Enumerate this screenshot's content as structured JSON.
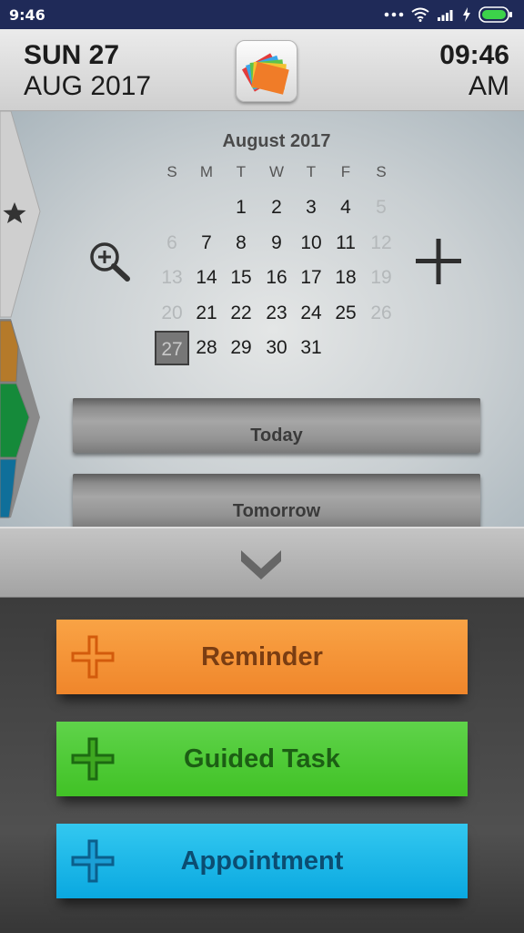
{
  "status_bar": {
    "time": "9:46"
  },
  "header": {
    "day_label": "SUN 27",
    "month_year": "AUG 2017",
    "time": "09:46",
    "ampm": "AM",
    "logo_icon": "stacked-cards-logo-icon"
  },
  "side_tabs": {
    "items": [
      {
        "name": "favorites",
        "icon": "star-icon",
        "color": "#cfcfcf"
      },
      {
        "name": "orange-tab",
        "color": "#b57a2a"
      },
      {
        "name": "green-tab",
        "color": "#158a3a"
      },
      {
        "name": "blue-tab",
        "color": "#0f6f9a"
      }
    ]
  },
  "calendar": {
    "month_title": "August 2017",
    "weekdays": [
      "S",
      "M",
      "T",
      "W",
      "T",
      "F",
      "S"
    ],
    "weeks": [
      [
        null,
        null,
        "1",
        "2",
        "3",
        "4",
        "5"
      ],
      [
        "6",
        "7",
        "8",
        "9",
        "10",
        "11",
        "12"
      ],
      [
        "13",
        "14",
        "15",
        "16",
        "17",
        "18",
        "19"
      ],
      [
        "20",
        "21",
        "22",
        "23",
        "24",
        "25",
        "26"
      ],
      [
        "27",
        "28",
        "29",
        "30",
        "31",
        null,
        null
      ]
    ],
    "selected_day": "27",
    "zoom_icon": "zoom-in-icon",
    "add_icon": "plus-icon"
  },
  "day_buttons": {
    "today": "Today",
    "tomorrow": "Tomorrow"
  },
  "collapse_icon": "chevron-down-icon",
  "actions": [
    {
      "label": "Reminder",
      "icon": "plus-icon",
      "color": "#f39237"
    },
    {
      "label": "Guided Task",
      "icon": "plus-icon",
      "color": "#4cc934"
    },
    {
      "label": "Appointment",
      "icon": "plus-icon",
      "color": "#1bb8ea"
    }
  ]
}
